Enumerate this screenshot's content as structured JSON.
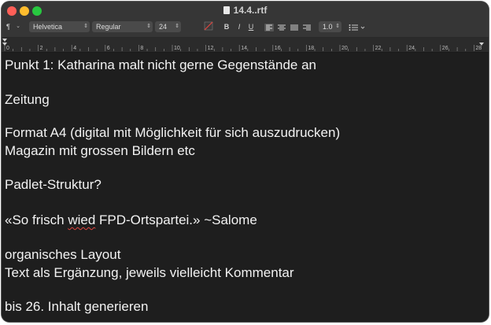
{
  "window": {
    "title": "14.4..rtf"
  },
  "toolbar": {
    "paragraph_style": "¶",
    "font_family": "Helvetica",
    "typeface": "Regular",
    "font_size": "24",
    "bold": "B",
    "italic": "I",
    "underline": "U",
    "line_spacing": "1.0",
    "text_color": "#ffffff"
  },
  "ruler": {
    "labels": [
      "0",
      "2",
      "4",
      "6",
      "8",
      "10",
      "12",
      "14",
      "16",
      "18",
      "20",
      "22",
      "24",
      "26",
      "28"
    ]
  },
  "document": {
    "line1": "Punkt 1: Katharina malt nicht gerne Gegenstände an",
    "line2": "Zeitung",
    "line3": "Format A4 (digital mit Möglichkeit für sich auszudrucken)",
    "line4": "Magazin mit grossen Bildern etc",
    "line5": "Padlet-Struktur?",
    "line6_pre": "«So frisch ",
    "line6_misspelled": "wied",
    "line6_post": " FPD-Ortspartei.» ~Salome",
    "line7": "organisches Layout",
    "line8": "Text als Ergänzung, jeweils vielleicht Kommentar",
    "line9": "bis 26. Inhalt generieren"
  }
}
